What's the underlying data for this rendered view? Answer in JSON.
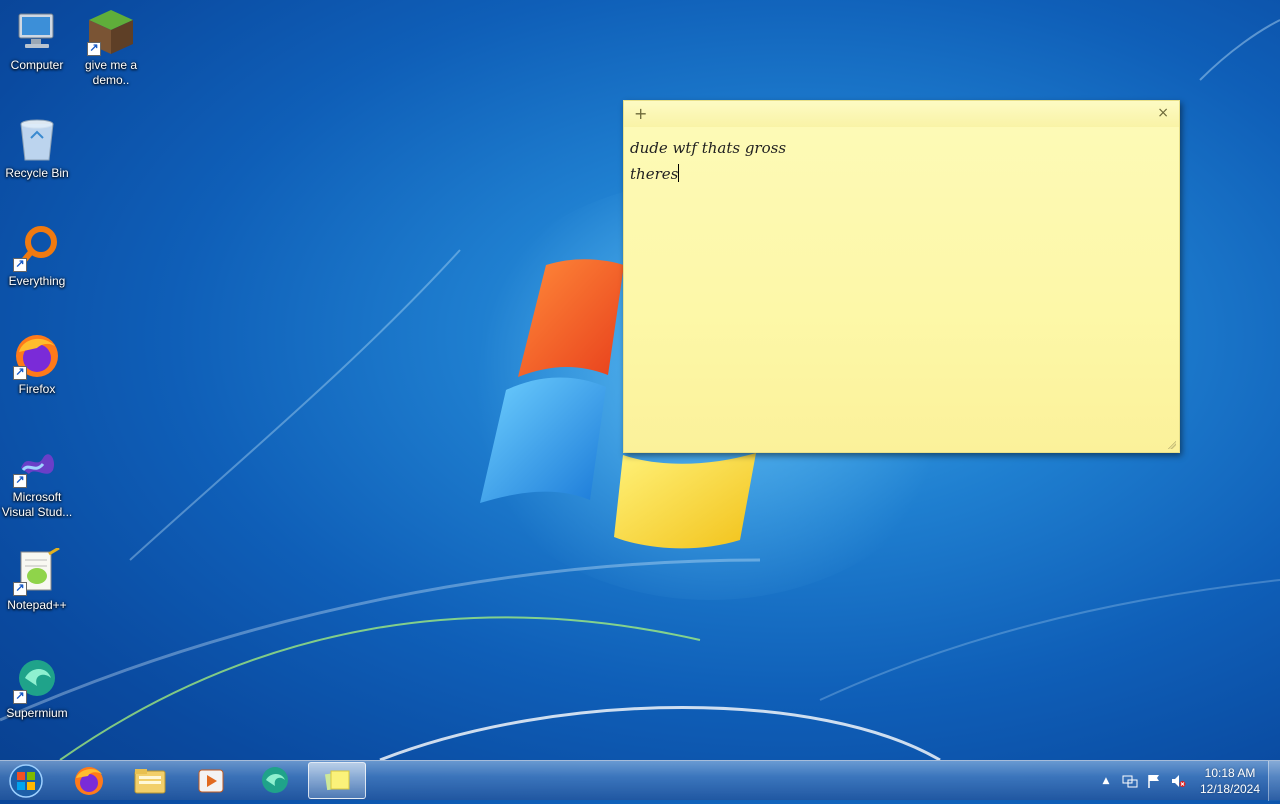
{
  "desktop": {
    "icons": [
      {
        "label": "Computer",
        "icon": "computer-icon"
      },
      {
        "label": "give me a demo..",
        "icon": "minecraft-grass-block-icon"
      },
      {
        "label": "Recycle Bin",
        "icon": "recycle-bin-icon"
      },
      {
        "label": "Everything",
        "icon": "everything-search-icon"
      },
      {
        "label": "Firefox",
        "icon": "firefox-icon"
      },
      {
        "label": "Microsoft Visual Stud...",
        "icon": "visual-studio-icon"
      },
      {
        "label": "Notepad++",
        "icon": "notepad-plus-plus-icon"
      },
      {
        "label": "Supermium",
        "icon": "supermium-icon"
      }
    ]
  },
  "sticky_note": {
    "add_symbol": "+",
    "close_symbol": "×",
    "lines": [
      "dude wtf thats gross",
      "theres"
    ],
    "color": "#fdf8a8"
  },
  "taskbar": {
    "items": [
      {
        "name": "firefox",
        "icon": "firefox-icon"
      },
      {
        "name": "windows-explorer",
        "icon": "folder-icon"
      },
      {
        "name": "media-player",
        "icon": "media-player-icon"
      },
      {
        "name": "supermium",
        "icon": "supermium-icon"
      },
      {
        "name": "sticky-notes",
        "icon": "sticky-notes-icon",
        "active": true
      }
    ],
    "tray": {
      "show_hidden": "▲",
      "time": "10:18 AM",
      "date": "12/18/2024"
    }
  }
}
